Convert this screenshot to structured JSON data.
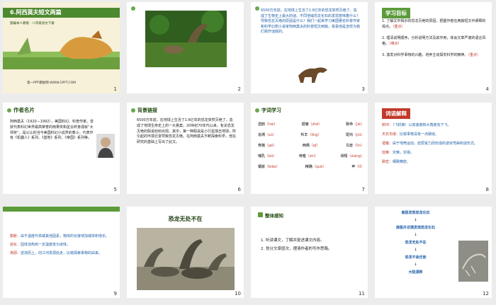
{
  "slides": [
    {
      "num": "1",
      "title": "6.阿西莫夫短文两篇",
      "subtitle": "部编本人教版 · 八年级语文下册",
      "footer": "第一PPT模板网-WWW.1PPT.COM"
    },
    {
      "num": "2"
    },
    {
      "num": "3",
      "text": "6500万年前，在地球上生活了1.6亿年的恐龙突然灭绝了，造成了生物史上最大的谜。不同地域恐龙化石的发现意味着什么？导致恐龙灭绝的原因是什么？我们一起来学习美国著名科普作家和科学幻想小说家阿西莫夫的科普短文两篇，看看他是怎样为我们揭开谜底的。"
    },
    {
      "num": "4",
      "heading": "学习目标",
      "items": [
        "1. 了解文中揭示的恐龙灭绝的原因，把握作者在两篇短文中阐释的观点。",
        "（重点）",
        "2. 理清说明顺序，分析说明方法及其作用，体会文章严谨的语言风格。",
        "（难点）",
        "3. 激发对科学事物的兴趣，培养主动探究科学的精神。",
        "（重点）"
      ]
    },
    {
      "num": "5",
      "heading": "作者名片",
      "text": "阿西莫夫（1920—1992），美国科幻、科普作家。曾获代表科幻世界最高荣誉的雨果奖和星云终身成就“大师奖”，是公认的当今美国科幻小说界的泰斗。代表作有《机器人》系列、《基地》系列、《帝国》系列等。"
    },
    {
      "num": "6",
      "heading": "背景链接",
      "text": "6500万年前，在地球上生活了1.6亿年的恐龙突然灭绝了，造成了地球生命史上的一大悬案。20世纪70年代以来，有关恐龙灭绝的假说纷纷出现。其中，第一种假说是小行星撞击地球，所引起的环境巨变导致恐龙灭绝。在阿西莫夫不断探索科学，他在研究的基础上写出了此文。"
    },
    {
      "num": "7",
      "heading": "字词学习",
      "words": [
        [
          "遗骸",
          "（hái）",
          "褶皱",
          "（zhě）",
          "致命",
          "（jié）"
        ],
        [
          "追溯",
          "（sù）",
          "羚羊",
          "（líng）",
          "斑鸠",
          "（jiū）"
        ],
        [
          "骨骼",
          "（gé）",
          "两栖",
          "（qī）",
          "鸟兽",
          "（lín）"
        ],
        [
          "哺乳",
          "（bǔ）",
          "啃噬",
          "（shì）",
          "滑翔",
          "（xiáng）"
        ],
        [
          "镶嵌",
          "（biǎo）",
          "精确",
          "（què）",
          "甲",
          "（lǐ）"
        ]
      ]
    },
    {
      "num": "8",
      "heading": "词语解释",
      "items": [
        {
          "term": "俯冲：",
          "def": "（飞机等）以高速度和大角度向下飞。"
        },
        {
          "term": "天衣无缝：",
          "def": "比喻事物没有一点破绽。"
        },
        {
          "term": "褶皱：",
          "def": "由于地壳运动，岩层受力而形成的波状弯曲构造形式。"
        },
        {
          "term": "劫难：",
          "def": "灾难，灾祸。"
        },
        {
          "term": "致密：",
          "def": "细致精密。"
        }
      ]
    },
    {
      "num": "9",
      "items": [
        {
          "term": "膨胀：",
          "def": "由于温度升高或其他因素，物体的长度增加或体积增长。"
        },
        {
          "term": "熔化：",
          "def": "固体加热到一定温度变为液体。"
        },
        {
          "term": "溯源：",
          "def": "逆流而上，向江河发源处走，比喻探索事物的由来。"
        }
      ]
    },
    {
      "num": "10",
      "heading": "恐龙无处不在"
    },
    {
      "num": "11",
      "heading": "整体感知",
      "items": [
        "1. 听读课文，了解并复述课文内容。",
        "2. 划分文章层次，理清作者的写作思路。"
      ]
    },
    {
      "num": "12",
      "flow": [
        "南极发现恐龙化石",
        "南极外访测发现恐龙化石",
        "恐龙无处不在",
        "恐龙不会迁徙",
        "大陆漂移"
      ]
    }
  ],
  "colors": {
    "green": "#5b9b3a",
    "accent": "#c0392b",
    "blue": "#1f5fa8",
    "selection": "#f5b041"
  }
}
